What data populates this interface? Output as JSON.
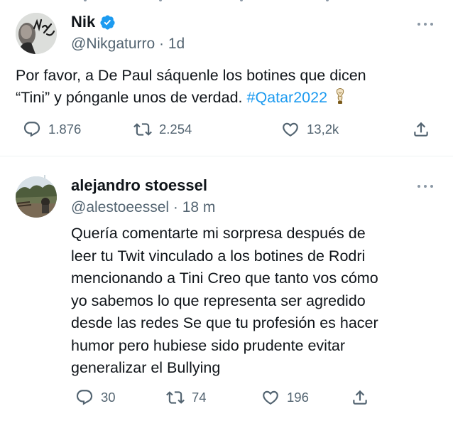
{
  "tweet1": {
    "author": {
      "name": "Nik",
      "handle": "@Nikgaturro",
      "time": "1d",
      "verified": true,
      "avatar_signature": "Nik"
    },
    "text_line1": "Por favor, a De Paul sáquenle los botines que dicen",
    "text_line2_pre": "“Tini” y pónganle unos de verdad. ",
    "hashtag": "#Qatar2022",
    "emoji": "trophy",
    "stats": {
      "replies": "1.876",
      "retweets": "2.254",
      "likes": "13,2k"
    }
  },
  "tweet2": {
    "author": {
      "name": "alejandro stoessel",
      "handle": "@alestoeessel",
      "time": "18 m"
    },
    "lines": [
      "Quería comentarte mi sorpresa después de",
      "leer tu Twit vinculado a los botines de Rodri",
      "mencionando a Tini Creo que tanto vos cómo",
      "yo sabemos lo que representa ser agredido",
      "desde las redes Se que tu profesión es hacer",
      "humor pero hubiese sido prudente evitar",
      "generalizar el Bullying"
    ],
    "stats": {
      "replies": "30",
      "retweets": "74",
      "likes": "196"
    }
  },
  "colors": {
    "accent": "#1d9bf0",
    "secondary_text": "#536471",
    "icon": "#536471"
  },
  "icons": [
    "verified-badge-icon",
    "more-icon",
    "reply-icon",
    "retweet-icon",
    "like-icon",
    "share-icon",
    "trophy-emoji-icon"
  ]
}
